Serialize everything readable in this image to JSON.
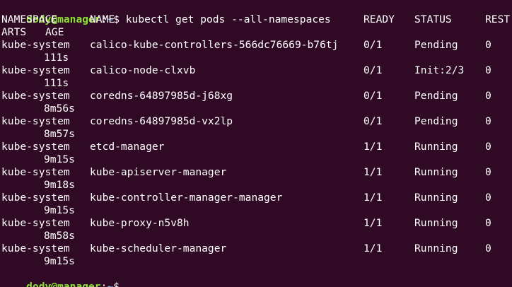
{
  "colors": {
    "background": "#300a24",
    "text": "#ffffff",
    "prompt_user": "#8ae234",
    "prompt_path": "#729fcf"
  },
  "prompt": {
    "user_host": "dody@manager",
    "separator": ":",
    "path": "~",
    "symbol": "$ ",
    "command": "kubectl get pods --all-namespaces"
  },
  "header": {
    "namespace": "NAMESPACE",
    "name": "NAME",
    "ready": "READY",
    "status": "STATUS",
    "rest": "REST",
    "arts": "ARTS",
    "age": "AGE"
  },
  "pods": [
    {
      "namespace": "kube-system",
      "name": "calico-kube-controllers-566dc76669-b76tj",
      "ready": "0/1",
      "status": "Pending",
      "restarts": "0",
      "age": "111s"
    },
    {
      "namespace": "kube-system",
      "name": "calico-node-clxvb",
      "ready": "0/1",
      "status": "Init:2/3",
      "restarts": "0",
      "age": "111s"
    },
    {
      "namespace": "kube-system",
      "name": "coredns-64897985d-j68xg",
      "ready": "0/1",
      "status": "Pending",
      "restarts": "0",
      "age": "8m56s"
    },
    {
      "namespace": "kube-system",
      "name": "coredns-64897985d-vx2lp",
      "ready": "0/1",
      "status": "Pending",
      "restarts": "0",
      "age": "8m57s"
    },
    {
      "namespace": "kube-system",
      "name": "etcd-manager",
      "ready": "1/1",
      "status": "Running",
      "restarts": "0",
      "age": "9m15s"
    },
    {
      "namespace": "kube-system",
      "name": "kube-apiserver-manager",
      "ready": "1/1",
      "status": "Running",
      "restarts": "0",
      "age": "9m18s"
    },
    {
      "namespace": "kube-system",
      "name": "kube-controller-manager-manager",
      "ready": "1/1",
      "status": "Running",
      "restarts": "0",
      "age": "9m15s"
    },
    {
      "namespace": "kube-system",
      "name": "kube-proxy-n5v8h",
      "ready": "1/1",
      "status": "Running",
      "restarts": "0",
      "age": "8m58s"
    },
    {
      "namespace": "kube-system",
      "name": "kube-scheduler-manager",
      "ready": "1/1",
      "status": "Running",
      "restarts": "0",
      "age": "9m15s"
    }
  ],
  "final_prompt": {
    "user_host": "dody@manager",
    "separator": ":",
    "path": "~",
    "symbol": "$ ",
    "cursor": "_"
  }
}
